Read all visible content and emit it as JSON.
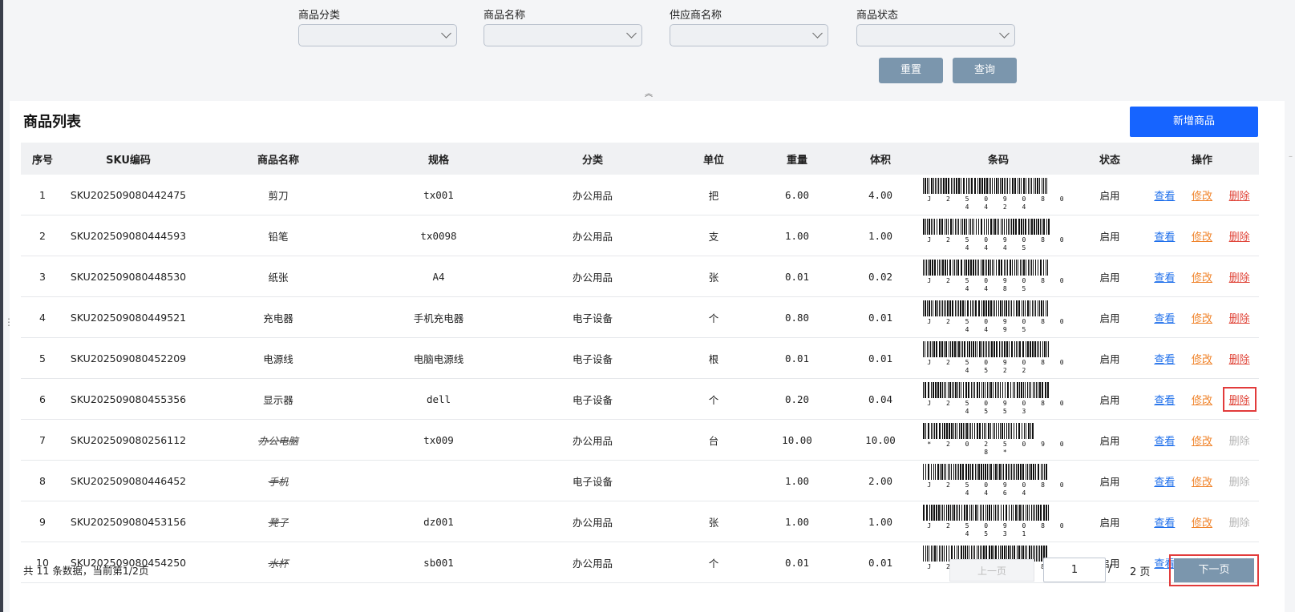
{
  "filters": [
    {
      "label": "商品分类",
      "value": ""
    },
    {
      "label": "商品名称",
      "value": ""
    },
    {
      "label": "供应商名称",
      "value": ""
    },
    {
      "label": "商品状态",
      "value": ""
    }
  ],
  "buttons": {
    "reset": "重置",
    "query": "查询",
    "add": "新增商品"
  },
  "list_title": "商品列表",
  "columns": [
    "序号",
    "SKU编码",
    "商品名称",
    "规格",
    "分类",
    "单位",
    "重量",
    "体积",
    "条码",
    "状态",
    "操作"
  ],
  "actions": {
    "view": "查看",
    "edit": "修改",
    "delete": "删除"
  },
  "rows": [
    {
      "no": "1",
      "sku": "SKU202509080442475",
      "name": "剪刀",
      "spec": "tx001",
      "category": "办公用品",
      "unit": "把",
      "weight": "6.00",
      "volume": "4.00",
      "barcode_text": "J 2 5 0 9 0 8 0 4 4 2 4",
      "status": "启用",
      "name_struck": false,
      "delete_enabled": true,
      "delete_highlight": false
    },
    {
      "no": "2",
      "sku": "SKU202509080444593",
      "name": "铅笔",
      "spec": "tx0098",
      "category": "办公用品",
      "unit": "支",
      "weight": "1.00",
      "volume": "1.00",
      "barcode_text": "J 2 5 0 9 0 8 0 4 4 4 5",
      "status": "启用",
      "name_struck": false,
      "delete_enabled": true,
      "delete_highlight": false
    },
    {
      "no": "3",
      "sku": "SKU202509080448530",
      "name": "纸张",
      "spec": "A4",
      "category": "办公用品",
      "unit": "张",
      "weight": "0.01",
      "volume": "0.02",
      "barcode_text": "J 2 5 0 9 0 8 0 4 4 8 5",
      "status": "启用",
      "name_struck": false,
      "delete_enabled": true,
      "delete_highlight": false
    },
    {
      "no": "4",
      "sku": "SKU202509080449521",
      "name": "充电器",
      "spec": "手机充电器",
      "category": "电子设备",
      "unit": "个",
      "weight": "0.80",
      "volume": "0.01",
      "barcode_text": "J 2 5 0 9 0 8 0 4 4 9 5",
      "status": "启用",
      "name_struck": false,
      "delete_enabled": true,
      "delete_highlight": false
    },
    {
      "no": "5",
      "sku": "SKU202509080452209",
      "name": "电源线",
      "spec": "电脑电源线",
      "category": "电子设备",
      "unit": "根",
      "weight": "0.01",
      "volume": "0.01",
      "barcode_text": "J 2 5 0 9 0 8 0 4 5 2 2",
      "status": "启用",
      "name_struck": false,
      "delete_enabled": true,
      "delete_highlight": false
    },
    {
      "no": "6",
      "sku": "SKU202509080455356",
      "name": "显示器",
      "spec": "dell",
      "category": "电子设备",
      "unit": "个",
      "weight": "0.20",
      "volume": "0.04",
      "barcode_text": "J 2 5 0 9 0 8 0 4 5 5 3",
      "status": "启用",
      "name_struck": false,
      "delete_enabled": true,
      "delete_highlight": true
    },
    {
      "no": "7",
      "sku": "SKU202509080256112",
      "name": "办公电脑",
      "spec": "tx009",
      "category": "办公用品",
      "unit": "台",
      "weight": "10.00",
      "volume": "10.00",
      "barcode_text": "* 2 0 2 5 0 9 0 8 *",
      "status": "启用",
      "name_struck": true,
      "delete_enabled": false,
      "delete_highlight": false
    },
    {
      "no": "8",
      "sku": "SKU202509080446452",
      "name": "手机",
      "spec": "",
      "category": "电子设备",
      "unit": "",
      "weight": "1.00",
      "volume": "2.00",
      "barcode_text": "J 2 5 0 9 0 8 0 4 4 6 4",
      "status": "启用",
      "name_struck": true,
      "delete_enabled": false,
      "delete_highlight": false
    },
    {
      "no": "9",
      "sku": "SKU202509080453156",
      "name": "凳子",
      "spec": "dz001",
      "category": "办公用品",
      "unit": "张",
      "weight": "1.00",
      "volume": "1.00",
      "barcode_text": "J 2 5 0 9 0 8 0 4 5 3 1",
      "status": "启用",
      "name_struck": true,
      "delete_enabled": false,
      "delete_highlight": false
    },
    {
      "no": "10",
      "sku": "SKU202509080454250",
      "name": "水杯",
      "spec": "sb001",
      "category": "办公用品",
      "unit": "个",
      "weight": "0.01",
      "volume": "0.01",
      "barcode_text": "J 2 5 0 9 0 8 0 4 5 4 2",
      "status": "启用",
      "name_struck": true,
      "delete_enabled": false,
      "delete_highlight": false
    }
  ],
  "pagination": {
    "summary": "共 11 条数据，当前第1/2页",
    "prev": "上一页",
    "current_page": "1",
    "separator": "/",
    "total_pages": "2 页",
    "next": "下一页"
  }
}
